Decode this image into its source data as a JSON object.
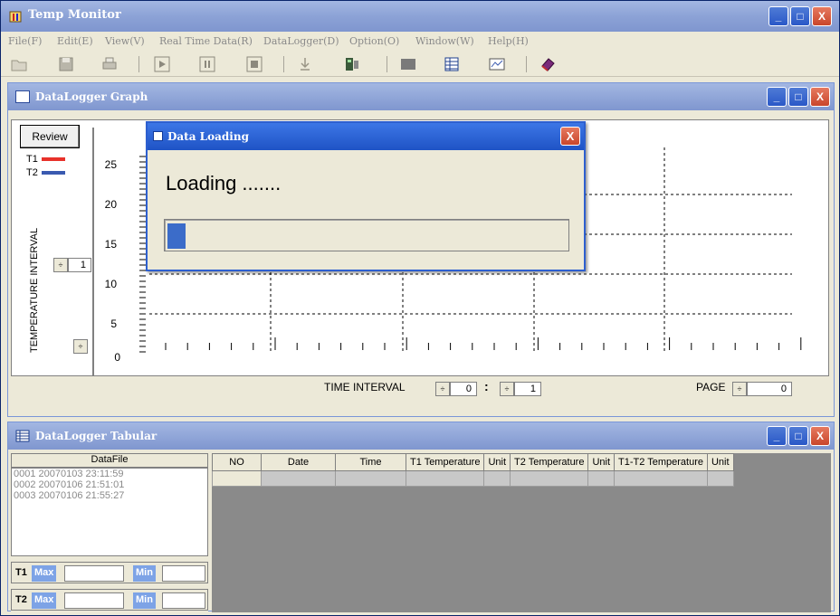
{
  "app": {
    "title": "Temp Monitor"
  },
  "window_controls": {
    "min": "_",
    "max": "□",
    "close": "X"
  },
  "menu": [
    {
      "label": "File(F)"
    },
    {
      "label": "Edit(E)"
    },
    {
      "label": "View(V)"
    },
    {
      "label": "Real Time Data(R)"
    },
    {
      "label": "DataLogger(D)"
    },
    {
      "label": "Option(O)"
    },
    {
      "label": "Window(W)"
    },
    {
      "label": "Help(H)"
    }
  ],
  "toolbar": {
    "icons": [
      "open-folder-icon",
      "save-icon",
      "print-icon",
      "play-icon",
      "pause-icon",
      "stop-icon",
      "download-icon",
      "datalogger-device-icon",
      "display-icon",
      "table-icon",
      "graph-icon",
      "book-icon"
    ]
  },
  "graph_window": {
    "title": "DataLogger Graph",
    "review_label": "Review",
    "legend": [
      {
        "name": "T1",
        "color": "#e8312a"
      },
      {
        "name": "T2",
        "color": "#3a5ab0"
      }
    ],
    "ylabel": "TEMPERATURE INTERVAL",
    "temperature_interval_value": "1",
    "y_ticks": [
      "25",
      "20",
      "15",
      "10",
      "5",
      "0"
    ],
    "time_interval_label": "TIME INTERVAL",
    "time_interval_a": "0",
    "time_separator": ":",
    "time_interval_b": "1",
    "page_label": "PAGE",
    "page_value": "0"
  },
  "dialog": {
    "title": "Data Loading",
    "message": "Loading .......",
    "progress": 0.045
  },
  "tabular_window": {
    "title": "DataLogger Tabular",
    "datafile_header": "DataFile",
    "datafiles": [
      "0001 20070103 23:11:59",
      "0002 20070106 21:51:01",
      "0003 20070106 21:55:27"
    ],
    "t1_label": "T1",
    "t2_label": "T2",
    "max_label": "Max",
    "min_label": "Min",
    "columns": [
      "NO",
      "Date",
      "Time",
      "T1 Temperature",
      "Unit",
      "T2 Temperature",
      "Unit",
      "T1-T2 Temperature",
      "Unit"
    ]
  },
  "colors": {
    "title_blue": "#7f96cf",
    "dialog_blue": "#1f53c5",
    "progress_fill": "#3b6cc9",
    "close_red": "#c9462b"
  }
}
